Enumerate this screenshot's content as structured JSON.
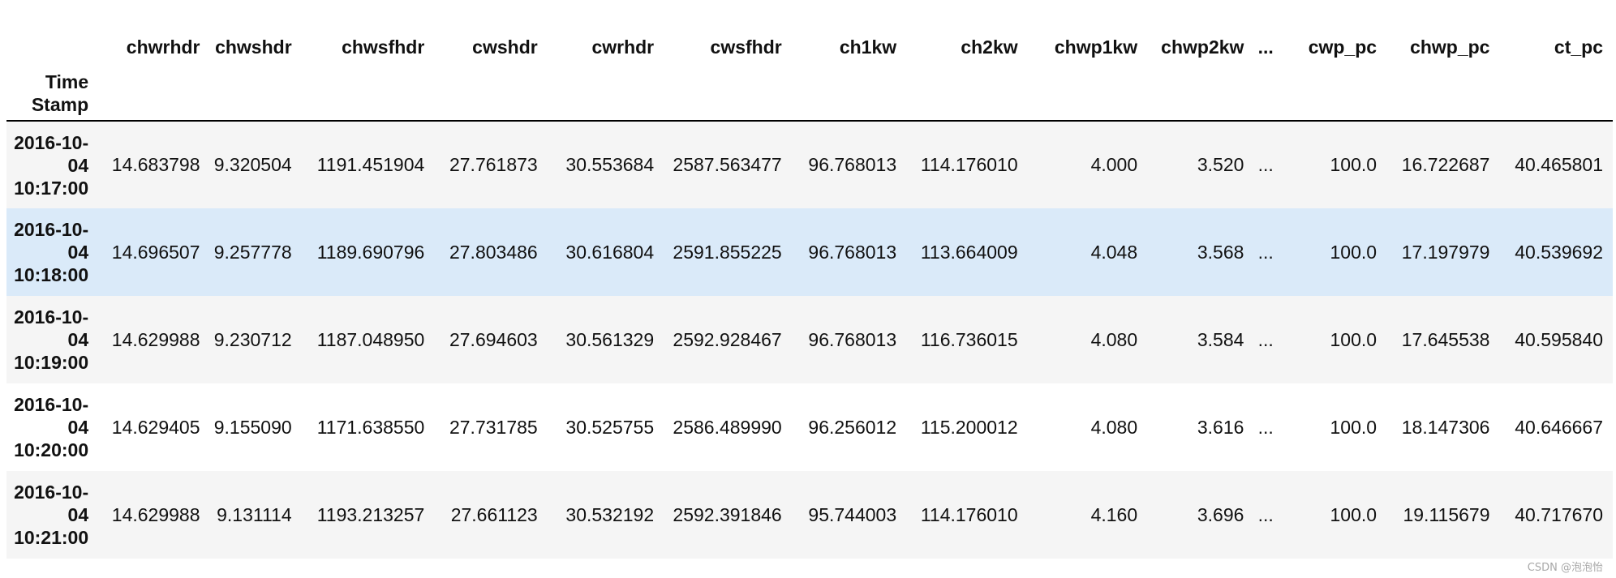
{
  "table": {
    "columns": [
      "chwrhdr",
      "chwshdr",
      "chwsfhdr",
      "cwshdr",
      "cwrhdr",
      "cwsfhdr",
      "ch1kw",
      "ch2kw",
      "chwp1kw",
      "chwp2kw",
      "...",
      "cwp_pc",
      "chwp_pc",
      "ct_pc"
    ],
    "index_name_lines": [
      "Time",
      "Stamp"
    ],
    "hovered_row": 1,
    "rows": [
      {
        "index_lines": [
          "2016-10-",
          "04",
          "10:17:00"
        ],
        "cells": [
          "14.683798",
          "9.320504",
          "1191.451904",
          "27.761873",
          "30.553684",
          "2587.563477",
          "96.768013",
          "114.176010",
          "4.000",
          "3.520",
          "...",
          "100.0",
          "16.722687",
          "40.465801"
        ]
      },
      {
        "index_lines": [
          "2016-10-",
          "04",
          "10:18:00"
        ],
        "cells": [
          "14.696507",
          "9.257778",
          "1189.690796",
          "27.803486",
          "30.616804",
          "2591.855225",
          "96.768013",
          "113.664009",
          "4.048",
          "3.568",
          "...",
          "100.0",
          "17.197979",
          "40.539692"
        ]
      },
      {
        "index_lines": [
          "2016-10-",
          "04",
          "10:19:00"
        ],
        "cells": [
          "14.629988",
          "9.230712",
          "1187.048950",
          "27.694603",
          "30.561329",
          "2592.928467",
          "96.768013",
          "116.736015",
          "4.080",
          "3.584",
          "...",
          "100.0",
          "17.645538",
          "40.595840"
        ]
      },
      {
        "index_lines": [
          "2016-10-",
          "04",
          "10:20:00"
        ],
        "cells": [
          "14.629405",
          "9.155090",
          "1171.638550",
          "27.731785",
          "30.525755",
          "2586.489990",
          "96.256012",
          "115.200012",
          "4.080",
          "3.616",
          "...",
          "100.0",
          "18.147306",
          "40.646667"
        ]
      },
      {
        "index_lines": [
          "2016-10-",
          "04",
          "10:21:00"
        ],
        "cells": [
          "14.629988",
          "9.131114",
          "1193.213257",
          "27.661123",
          "30.532192",
          "2592.391846",
          "95.744003",
          "114.176010",
          "4.160",
          "3.696",
          "...",
          "100.0",
          "19.115679",
          "40.717670"
        ]
      }
    ]
  },
  "watermark": "CSDN @泡泡怡",
  "colors": {
    "row_stripe": "#f5f5f5",
    "row_hover": "#daeaf9",
    "header_rule": "#000000",
    "watermark": "#a8a8a8"
  }
}
